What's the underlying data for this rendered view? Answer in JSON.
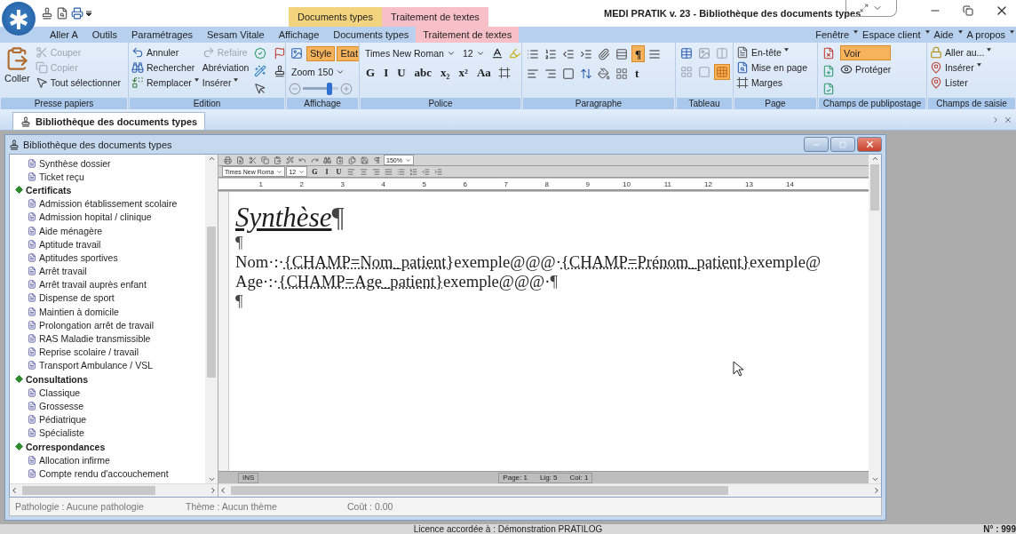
{
  "title_bar": {
    "title": "MEDI PRATIK v. 23 - Bibliothèque des documents types",
    "contextual_tabs": [
      {
        "label": "Documents types",
        "color": "#f3d47e"
      },
      {
        "label": "Traitement de textes",
        "color": "#f7bfc8"
      }
    ]
  },
  "menu": {
    "tabs": [
      {
        "label": "Aller A",
        "selected": false
      },
      {
        "label": "Outils",
        "selected": false
      },
      {
        "label": "Paramétrages",
        "selected": false
      },
      {
        "label": "Sesam Vitale",
        "selected": false
      },
      {
        "label": "Affichage",
        "selected": false
      },
      {
        "label": "Documents types",
        "selected": false
      },
      {
        "label": "Traitement de textes",
        "selected": true
      }
    ],
    "right": [
      {
        "label": "Fenêtre"
      },
      {
        "label": "Espace client"
      },
      {
        "label": "Aide"
      },
      {
        "label": "A propos"
      }
    ]
  },
  "ribbon": {
    "groups": [
      {
        "label": "Presse papiers",
        "kind": "columns",
        "cells": [
          [
            {
              "kind": "large",
              "label": "Coller"
            }
          ],
          [
            {
              "kind": "small",
              "label": "Couper",
              "disabled": true
            },
            {
              "kind": "small",
              "label": "Copier",
              "disabled": true
            },
            {
              "kind": "small",
              "label": "Tout sélectionner",
              "disabled": false
            }
          ]
        ]
      },
      {
        "label": "Edition",
        "kind": "columns",
        "cells": [
          [
            {
              "kind": "small",
              "label": "Annuler",
              "disabled": false
            },
            {
              "kind": "small",
              "label": "Rechercher",
              "disabled": false
            },
            {
              "kind": "small",
              "label": "Remplacer",
              "disabled": false,
              "dropdown": true
            }
          ],
          [
            {
              "kind": "small",
              "label": "Refaire",
              "disabled": true
            },
            {
              "kind": "text",
              "label": "Abréviation",
              "disabled": false
            },
            {
              "kind": "text",
              "label": "Insérer",
              "disabled": false,
              "dropdown": true
            }
          ],
          [
            {
              "kind": "icon"
            },
            {
              "kind": "icon"
            },
            {
              "kind": "icon"
            }
          ],
          [
            {
              "kind": "icon"
            },
            {
              "kind": "icon"
            }
          ]
        ]
      },
      {
        "label": "Affichage",
        "kind": "rows",
        "cells": [
          [
            {
              "kind": "icon"
            },
            {
              "kind": "toggle",
              "label": "Style",
              "selected": true
            },
            {
              "kind": "toggle",
              "label": "Etat",
              "selected": true
            }
          ],
          [
            {
              "kind": "select",
              "label": "Zoom 150"
            }
          ],
          [
            {
              "kind": "slider",
              "level": 0.75
            }
          ]
        ]
      },
      {
        "label": "Police",
        "kind": "rows",
        "cells": [
          [
            {
              "kind": "select",
              "label": "Times New Roman"
            },
            {
              "kind": "select",
              "label": "12"
            },
            {
              "kind": "icon"
            },
            {
              "kind": "icon"
            }
          ],
          [
            {
              "kind": "format",
              "label": "G",
              "selected": false
            },
            {
              "kind": "format",
              "label": "I",
              "selected": false
            },
            {
              "kind": "format",
              "label": "U",
              "selected": false
            },
            {
              "kind": "format",
              "label": "abc",
              "selected": false
            },
            {
              "kind": "format",
              "label": "x₂",
              "selected": false
            },
            {
              "kind": "format",
              "label": "x²",
              "selected": false
            },
            {
              "kind": "format",
              "label": "Aa",
              "selected": false
            },
            {
              "kind": "icon"
            }
          ]
        ]
      },
      {
        "label": "Paragraphe",
        "kind": "rows",
        "cells": [
          [
            {
              "kind": "icon",
              "selected": false
            },
            {
              "kind": "icon",
              "selected": false
            },
            {
              "kind": "icon",
              "selected": false
            },
            {
              "kind": "icon",
              "selected": false
            },
            {
              "kind": "icon",
              "selected": false
            },
            {
              "kind": "icon",
              "selected": false
            },
            {
              "kind": "format",
              "label": "¶",
              "selected": true
            },
            {
              "kind": "icon",
              "selected": false
            }
          ],
          [
            {
              "kind": "icon",
              "selected": false
            },
            {
              "kind": "icon",
              "selected": false
            },
            {
              "kind": "icon",
              "selected": false
            },
            {
              "kind": "icon",
              "selected": false
            },
            {
              "kind": "icon",
              "selected": false
            },
            {
              "kind": "icon",
              "selected": false
            },
            {
              "kind": "format",
              "label": "t",
              "selected": false
            }
          ]
        ]
      },
      {
        "label": "Tableau",
        "kind": "rows",
        "cells": [
          [
            {
              "kind": "icon",
              "selected": false
            },
            {
              "kind": "icon",
              "selected": false
            },
            {
              "kind": "icon",
              "selected": false
            }
          ],
          [
            {
              "kind": "icon",
              "selected": false
            },
            {
              "kind": "icon",
              "selected": false
            },
            {
              "kind": "icon",
              "selected": true
            }
          ]
        ]
      },
      {
        "label": "Page",
        "kind": "columns",
        "cells": [
          [
            {
              "kind": "small",
              "label": "En-tête",
              "disabled": false,
              "dropdown": true
            },
            {
              "kind": "small",
              "label": "Mise en page",
              "disabled": false
            },
            {
              "kind": "small",
              "label": "Marges",
              "disabled": false
            }
          ]
        ]
      },
      {
        "label": "Champs de publipostage",
        "kind": "columns",
        "cells": [
          [
            {
              "kind": "icon"
            },
            {
              "kind": "icon"
            },
            {
              "kind": "icon"
            }
          ],
          [
            {
              "kind": "toggle",
              "label": "Voir",
              "selected": true
            },
            {
              "kind": "small",
              "label": "Protéger",
              "disabled": false
            }
          ]
        ]
      },
      {
        "label": "Champs de saisie",
        "kind": "columns",
        "cells": [
          [
            {
              "kind": "small",
              "label": "Aller au...",
              "disabled": false,
              "dropdown": true
            },
            {
              "kind": "small",
              "label": "Insérer",
              "disabled": false,
              "dropdown": true
            },
            {
              "kind": "small",
              "label": "Lister",
              "disabled": false
            }
          ]
        ]
      }
    ]
  },
  "document_tab": {
    "label": "Bibliothèque des documents types"
  },
  "child_window": {
    "title": "Bibliothèque des documents types",
    "tree": [
      {
        "kind": "doc",
        "label": "Synthèse dossier"
      },
      {
        "kind": "doc",
        "label": "Ticket reçu"
      },
      {
        "kind": "folder",
        "label": "Certificats",
        "expanded": true,
        "children": [
          {
            "kind": "doc",
            "label": "Admission établissement scolaire"
          },
          {
            "kind": "doc",
            "label": "Admission hopital / clinique"
          },
          {
            "kind": "doc",
            "label": "Aide ménagère"
          },
          {
            "kind": "doc",
            "label": "Aptitude travail"
          },
          {
            "kind": "doc",
            "label": "Aptitudes sportives"
          },
          {
            "kind": "doc",
            "label": "Arrêt travail"
          },
          {
            "kind": "doc",
            "label": "Arrêt travail auprès enfant"
          },
          {
            "kind": "doc",
            "label": "Dispense de sport"
          },
          {
            "kind": "doc",
            "label": "Maintien à domicile"
          },
          {
            "kind": "doc",
            "label": "Prolongation arrêt de travail"
          },
          {
            "kind": "doc",
            "label": "RAS Maladie transmissible"
          },
          {
            "kind": "doc",
            "label": "Reprise scolaire / travail"
          },
          {
            "kind": "doc",
            "label": "Transport Ambulance / VSL"
          }
        ]
      },
      {
        "kind": "folder",
        "label": "Consultations",
        "expanded": true,
        "children": [
          {
            "kind": "doc",
            "label": "Classique"
          },
          {
            "kind": "doc",
            "label": "Grossesse"
          },
          {
            "kind": "doc",
            "label": "Pédiatrique"
          },
          {
            "kind": "doc",
            "label": "Spécialiste"
          }
        ]
      },
      {
        "kind": "folder",
        "label": "Correspondances",
        "expanded": true,
        "children": [
          {
            "kind": "doc",
            "label": "Allocation infirme"
          },
          {
            "kind": "doc",
            "label": "Compte rendu d'accouchement"
          }
        ]
      }
    ],
    "editor": {
      "toolbar": [
        [
          {
            "kind": "icon"
          },
          {
            "kind": "icon"
          },
          {
            "kind": "icon"
          },
          {
            "kind": "icon"
          },
          {
            "kind": "icon"
          },
          {
            "kind": "icon"
          },
          {
            "kind": "icon"
          },
          {
            "kind": "icon"
          },
          {
            "kind": "icon"
          },
          {
            "kind": "icon"
          },
          {
            "kind": "icon"
          },
          {
            "kind": "icon"
          },
          {
            "kind": "icon"
          },
          {
            "kind": "select",
            "label": "150%"
          }
        ],
        [
          {
            "kind": "select",
            "label": "Times New Roma"
          },
          {
            "kind": "select",
            "label": "12"
          },
          {
            "kind": "format",
            "label": "G",
            "selected": false
          },
          {
            "kind": "format",
            "label": "I",
            "selected": false
          },
          {
            "kind": "format",
            "label": "U",
            "selected": false
          },
          {
            "kind": "icon"
          },
          {
            "kind": "icon"
          },
          {
            "kind": "icon"
          },
          {
            "kind": "icon"
          },
          {
            "kind": "icon"
          },
          {
            "kind": "icon"
          },
          {
            "kind": "icon"
          },
          {
            "kind": "icon"
          }
        ]
      ],
      "ruler": [
        "1",
        "2",
        "3",
        "4",
        "5",
        "6",
        "7",
        "8",
        "9",
        "10",
        "11",
        "12",
        "13",
        "14"
      ],
      "lines": [
        {
          "kind": "title",
          "segments": [
            {
              "kind": "text",
              "text": "Synthèse"
            },
            {
              "kind": "mark",
              "text": "¶"
            }
          ]
        },
        {
          "kind": "body",
          "segments": [
            {
              "kind": "mark",
              "text": "¶"
            }
          ]
        },
        {
          "kind": "body",
          "segments": [
            {
              "kind": "text",
              "text": "Nom·:·"
            },
            {
              "kind": "field",
              "text": "{CHAMP=Nom_patient}"
            },
            {
              "kind": "text",
              "text": "exemple@@@·"
            },
            {
              "kind": "field",
              "text": "{CHAMP=Prénom_patient}"
            },
            {
              "kind": "text",
              "text": "exemple@"
            }
          ]
        },
        {
          "kind": "body",
          "segments": [
            {
              "kind": "text",
              "text": "Age·:·"
            },
            {
              "kind": "field",
              "text": "{CHAMP=Age_patient}"
            },
            {
              "kind": "text",
              "text": "exemple@@@·"
            },
            {
              "kind": "mark",
              "text": "¶"
            }
          ]
        },
        {
          "kind": "body",
          "segments": [
            {
              "kind": "mark",
              "text": "¶"
            }
          ]
        }
      ],
      "status": {
        "mode": "INS",
        "page": "Page: 1",
        "line": "Lig: 5",
        "column": "Col: 1"
      }
    },
    "status": [
      {
        "label": "Pathologie :",
        "value": "Aucune pathologie"
      },
      {
        "label": "Thème :",
        "value": "Aucun thème"
      },
      {
        "label": "Coût :",
        "value": "0.00"
      }
    ]
  },
  "status_bar": {
    "license": "Licence accordée à : Démonstration PRATILOG",
    "number": "N° : 999"
  }
}
